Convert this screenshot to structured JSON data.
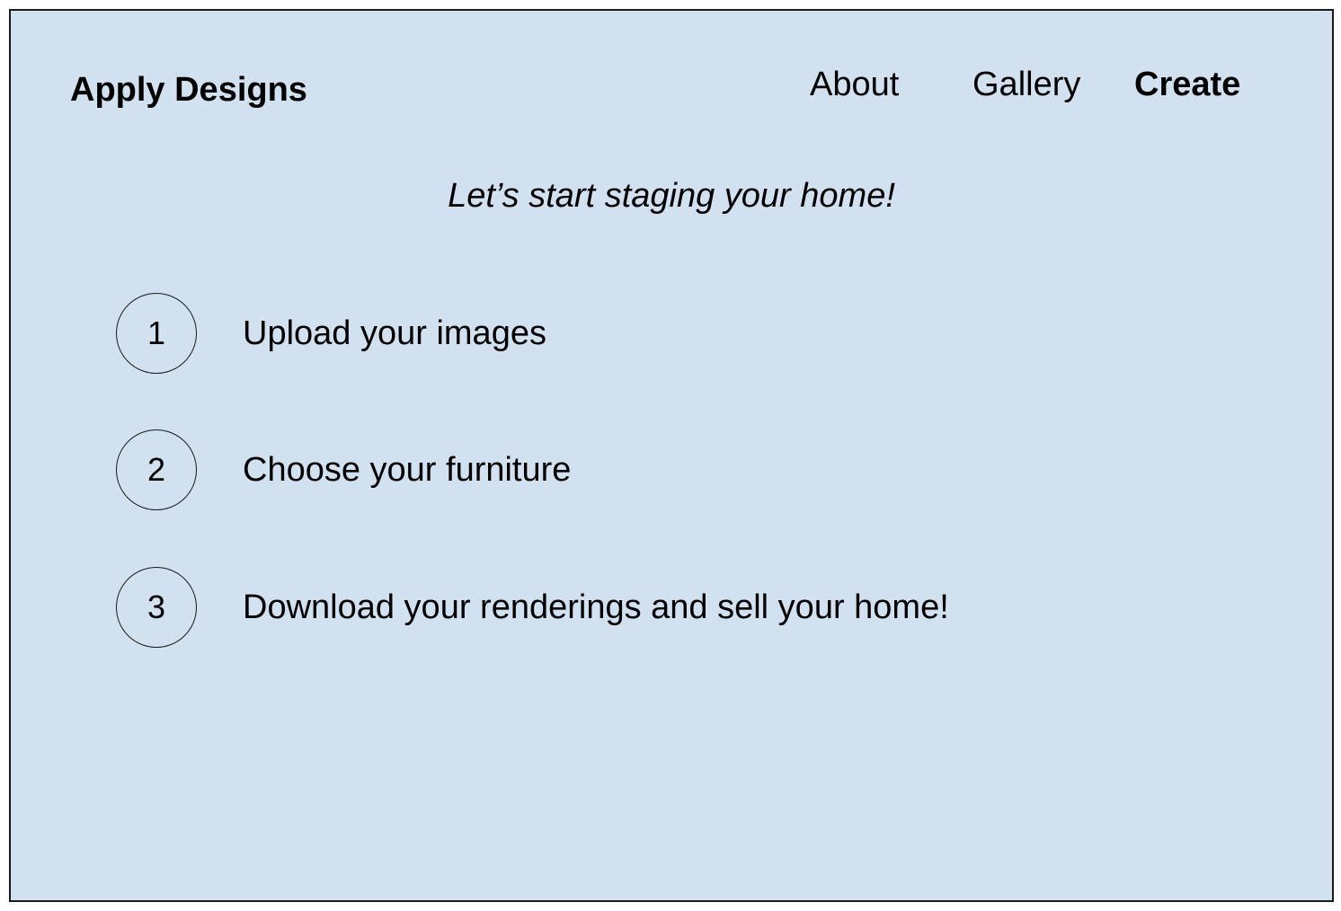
{
  "header": {
    "brand": "Apply Designs",
    "nav": [
      {
        "label": "About"
      },
      {
        "label": "Gallery"
      },
      {
        "label": "Create",
        "active": true
      }
    ]
  },
  "main": {
    "tagline": "Let’s start staging your home!",
    "steps": [
      {
        "number": "1",
        "label": "Upload your images"
      },
      {
        "number": "2",
        "label": "Choose your furniture"
      },
      {
        "number": "3",
        "label": "Download your renderings and sell your home!"
      }
    ]
  },
  "colors": {
    "background": "#d2e1f0",
    "border": "#1a1a1a",
    "text": "#000000"
  }
}
